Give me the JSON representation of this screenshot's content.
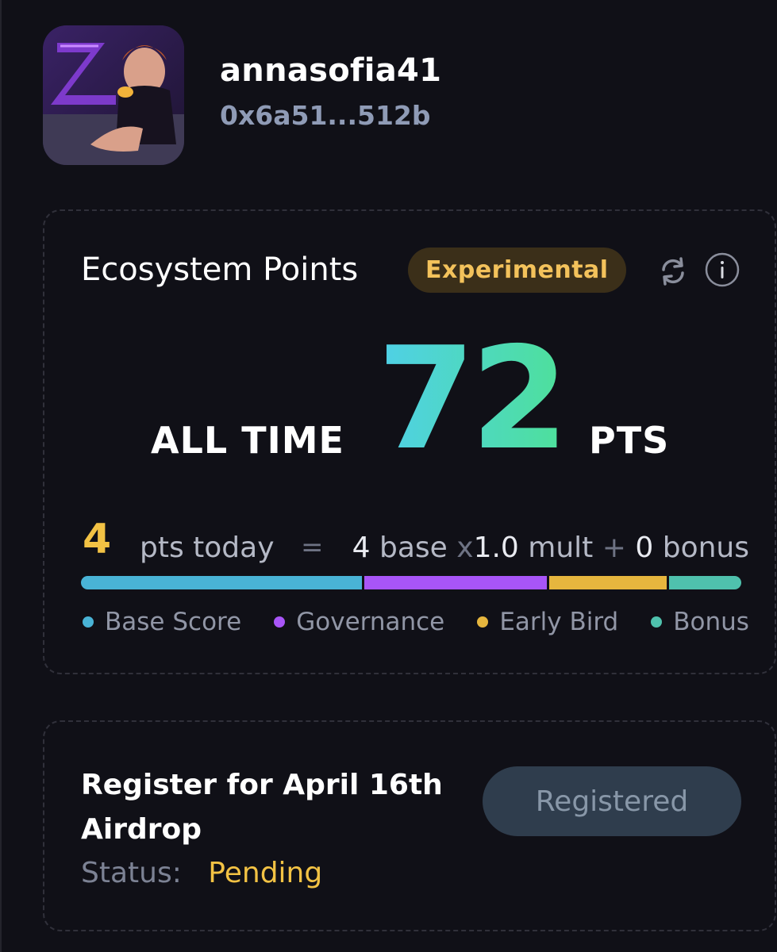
{
  "profile": {
    "username": "annasofia41",
    "wallet": "0x6a51...512b",
    "avatar_icon": "avatar-photo"
  },
  "points": {
    "title": "Ecosystem Points",
    "badge": "Experimental",
    "refresh_icon": "refresh-icon",
    "info_icon": "info-icon",
    "alltime_label": "ALL TIME",
    "alltime_value": "72",
    "pts_label": "PTS",
    "today_value": "4",
    "today_label": "pts today",
    "equals": "=",
    "base_value": "4",
    "base_label": "base",
    "times": "x",
    "mult_value": "1.0",
    "mult_label": "mult",
    "plus": "+",
    "bonus_value": "0",
    "bonus_label": "bonus",
    "breakdown": [
      {
        "name": "Base Score",
        "color": "#49b3d6",
        "share": 0.43
      },
      {
        "name": "Governance",
        "color": "#a855f7",
        "share": 0.28
      },
      {
        "name": "Early Bird",
        "color": "#e6b63e",
        "share": 0.18
      },
      {
        "name": "Bonus",
        "color": "#4fc1ad",
        "share": 0.11
      }
    ],
    "gradient": {
      "start": "#4fd0e8",
      "end": "#4ee09a"
    }
  },
  "airdrop": {
    "title": "Register for April 16th Airdrop",
    "status_label": "Status:",
    "status_value": "Pending",
    "button_label": "Registered"
  }
}
